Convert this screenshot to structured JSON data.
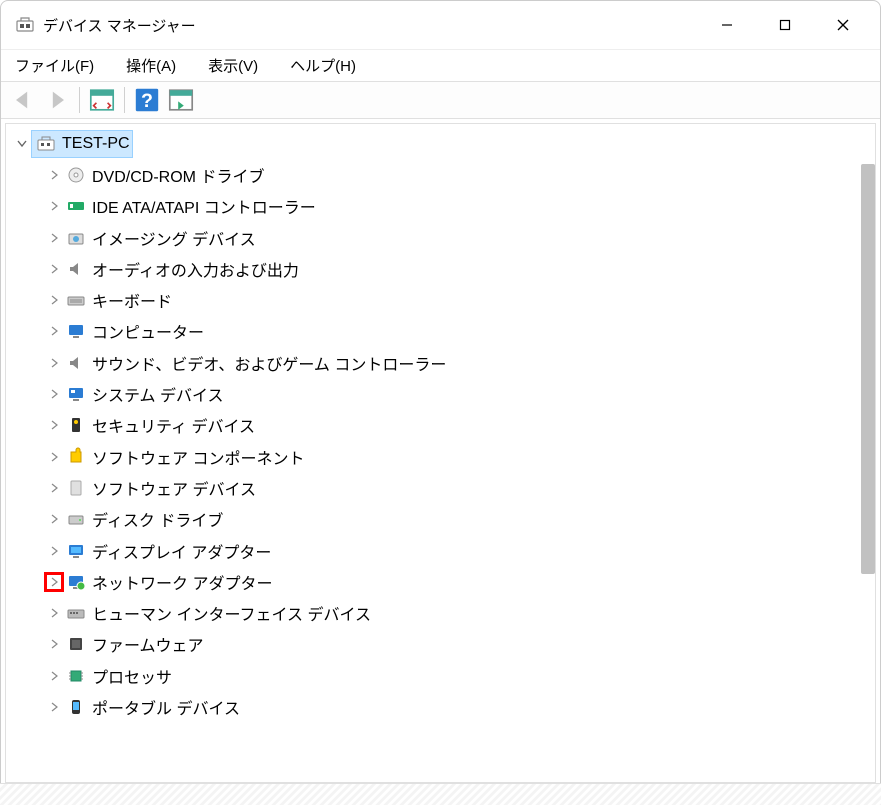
{
  "window": {
    "title": "デバイス マネージャー"
  },
  "menubar": {
    "file": "ファイル(F)",
    "action": "操作(A)",
    "view": "表示(V)",
    "help": "ヘルプ(H)"
  },
  "tree": {
    "root": "TEST-PC",
    "items": [
      "DVD/CD-ROM ドライブ",
      "IDE ATA/ATAPI コントローラー",
      "イメージング デバイス",
      "オーディオの入力および出力",
      "キーボード",
      "コンピューター",
      "サウンド、ビデオ、およびゲーム コントローラー",
      "システム デバイス",
      "セキュリティ デバイス",
      "ソフトウェア コンポーネント",
      "ソフトウェア デバイス",
      "ディスク ドライブ",
      "ディスプレイ アダプター",
      "ネットワーク アダプター",
      "ヒューマン インターフェイス デバイス",
      "ファームウェア",
      "プロセッサ",
      "ポータブル デバイス"
    ],
    "highlightIndex": 13
  }
}
